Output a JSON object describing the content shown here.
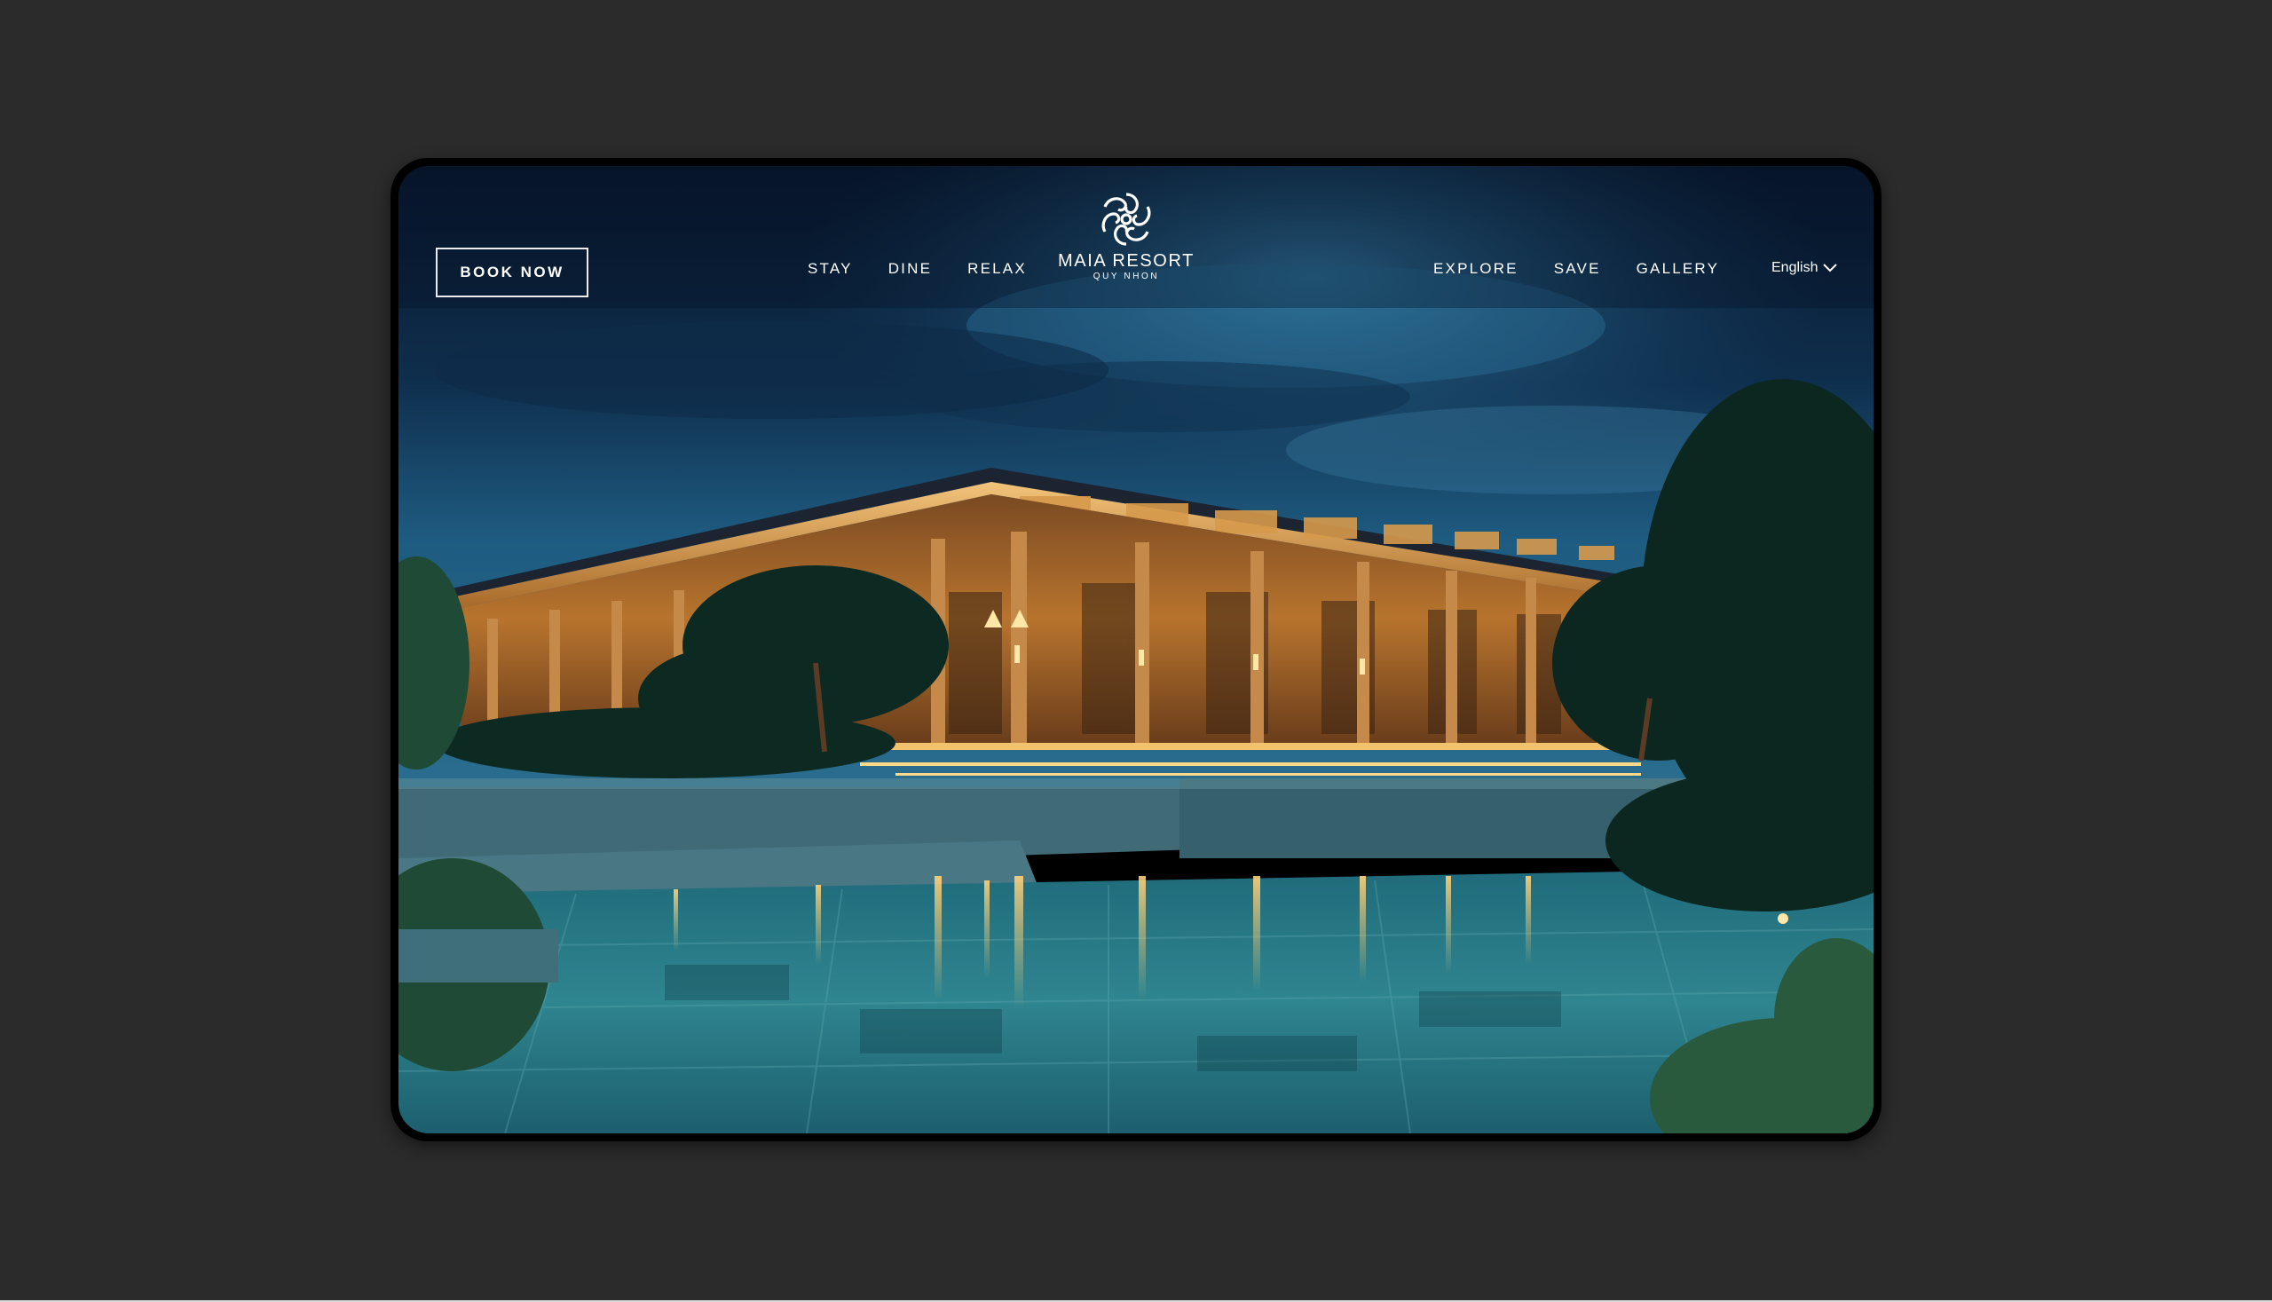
{
  "header": {
    "book_label": "BOOK NOW",
    "nav_left": [
      "STAY",
      "DINE",
      "RELAX"
    ],
    "nav_right": [
      "EXPLORE",
      "SAVE",
      "GALLERY"
    ],
    "logo": {
      "name": "MAIA RESORT",
      "subtitle": "QUY NHON",
      "icon": "flower-logo-icon"
    },
    "language": {
      "selected": "English",
      "icon": "chevron-down-icon"
    }
  },
  "hero": {
    "image": "night-resort-pavilion-with-pool"
  },
  "colors": {
    "backdrop": "#2b2b2b",
    "sky_top": "#0b1d33",
    "sky_mid": "#1b4f74",
    "pool": "#2f7f8a",
    "light": "#f5c46a"
  }
}
